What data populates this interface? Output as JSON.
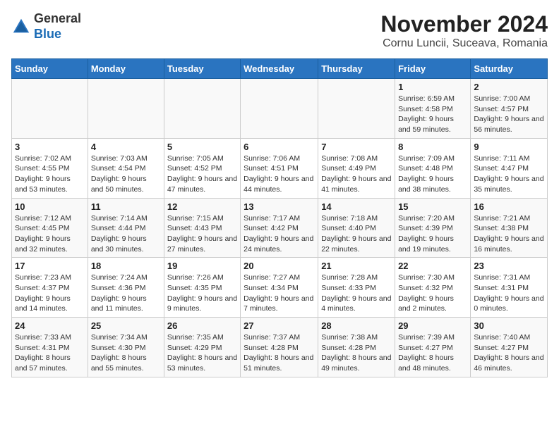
{
  "header": {
    "logo_line1": "General",
    "logo_line2": "Blue",
    "month": "November 2024",
    "location": "Cornu Luncii, Suceava, Romania"
  },
  "weekdays": [
    "Sunday",
    "Monday",
    "Tuesday",
    "Wednesday",
    "Thursday",
    "Friday",
    "Saturday"
  ],
  "weeks": [
    [
      {
        "day": "",
        "info": ""
      },
      {
        "day": "",
        "info": ""
      },
      {
        "day": "",
        "info": ""
      },
      {
        "day": "",
        "info": ""
      },
      {
        "day": "",
        "info": ""
      },
      {
        "day": "1",
        "info": "Sunrise: 6:59 AM\nSunset: 4:58 PM\nDaylight: 9 hours and 59 minutes."
      },
      {
        "day": "2",
        "info": "Sunrise: 7:00 AM\nSunset: 4:57 PM\nDaylight: 9 hours and 56 minutes."
      }
    ],
    [
      {
        "day": "3",
        "info": "Sunrise: 7:02 AM\nSunset: 4:55 PM\nDaylight: 9 hours and 53 minutes."
      },
      {
        "day": "4",
        "info": "Sunrise: 7:03 AM\nSunset: 4:54 PM\nDaylight: 9 hours and 50 minutes."
      },
      {
        "day": "5",
        "info": "Sunrise: 7:05 AM\nSunset: 4:52 PM\nDaylight: 9 hours and 47 minutes."
      },
      {
        "day": "6",
        "info": "Sunrise: 7:06 AM\nSunset: 4:51 PM\nDaylight: 9 hours and 44 minutes."
      },
      {
        "day": "7",
        "info": "Sunrise: 7:08 AM\nSunset: 4:49 PM\nDaylight: 9 hours and 41 minutes."
      },
      {
        "day": "8",
        "info": "Sunrise: 7:09 AM\nSunset: 4:48 PM\nDaylight: 9 hours and 38 minutes."
      },
      {
        "day": "9",
        "info": "Sunrise: 7:11 AM\nSunset: 4:47 PM\nDaylight: 9 hours and 35 minutes."
      }
    ],
    [
      {
        "day": "10",
        "info": "Sunrise: 7:12 AM\nSunset: 4:45 PM\nDaylight: 9 hours and 32 minutes."
      },
      {
        "day": "11",
        "info": "Sunrise: 7:14 AM\nSunset: 4:44 PM\nDaylight: 9 hours and 30 minutes."
      },
      {
        "day": "12",
        "info": "Sunrise: 7:15 AM\nSunset: 4:43 PM\nDaylight: 9 hours and 27 minutes."
      },
      {
        "day": "13",
        "info": "Sunrise: 7:17 AM\nSunset: 4:42 PM\nDaylight: 9 hours and 24 minutes."
      },
      {
        "day": "14",
        "info": "Sunrise: 7:18 AM\nSunset: 4:40 PM\nDaylight: 9 hours and 22 minutes."
      },
      {
        "day": "15",
        "info": "Sunrise: 7:20 AM\nSunset: 4:39 PM\nDaylight: 9 hours and 19 minutes."
      },
      {
        "day": "16",
        "info": "Sunrise: 7:21 AM\nSunset: 4:38 PM\nDaylight: 9 hours and 16 minutes."
      }
    ],
    [
      {
        "day": "17",
        "info": "Sunrise: 7:23 AM\nSunset: 4:37 PM\nDaylight: 9 hours and 14 minutes."
      },
      {
        "day": "18",
        "info": "Sunrise: 7:24 AM\nSunset: 4:36 PM\nDaylight: 9 hours and 11 minutes."
      },
      {
        "day": "19",
        "info": "Sunrise: 7:26 AM\nSunset: 4:35 PM\nDaylight: 9 hours and 9 minutes."
      },
      {
        "day": "20",
        "info": "Sunrise: 7:27 AM\nSunset: 4:34 PM\nDaylight: 9 hours and 7 minutes."
      },
      {
        "day": "21",
        "info": "Sunrise: 7:28 AM\nSunset: 4:33 PM\nDaylight: 9 hours and 4 minutes."
      },
      {
        "day": "22",
        "info": "Sunrise: 7:30 AM\nSunset: 4:32 PM\nDaylight: 9 hours and 2 minutes."
      },
      {
        "day": "23",
        "info": "Sunrise: 7:31 AM\nSunset: 4:31 PM\nDaylight: 9 hours and 0 minutes."
      }
    ],
    [
      {
        "day": "24",
        "info": "Sunrise: 7:33 AM\nSunset: 4:31 PM\nDaylight: 8 hours and 57 minutes."
      },
      {
        "day": "25",
        "info": "Sunrise: 7:34 AM\nSunset: 4:30 PM\nDaylight: 8 hours and 55 minutes."
      },
      {
        "day": "26",
        "info": "Sunrise: 7:35 AM\nSunset: 4:29 PM\nDaylight: 8 hours and 53 minutes."
      },
      {
        "day": "27",
        "info": "Sunrise: 7:37 AM\nSunset: 4:28 PM\nDaylight: 8 hours and 51 minutes."
      },
      {
        "day": "28",
        "info": "Sunrise: 7:38 AM\nSunset: 4:28 PM\nDaylight: 8 hours and 49 minutes."
      },
      {
        "day": "29",
        "info": "Sunrise: 7:39 AM\nSunset: 4:27 PM\nDaylight: 8 hours and 48 minutes."
      },
      {
        "day": "30",
        "info": "Sunrise: 7:40 AM\nSunset: 4:27 PM\nDaylight: 8 hours and 46 minutes."
      }
    ]
  ]
}
